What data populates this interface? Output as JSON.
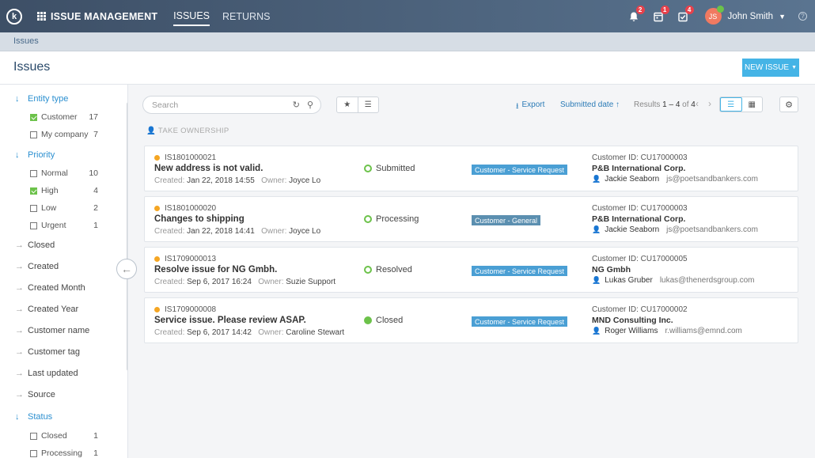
{
  "header": {
    "logo_letter": "k",
    "app_title": "ISSUE MANAGEMENT",
    "tabs": [
      {
        "label": "ISSUES"
      },
      {
        "label": "RETURNS"
      }
    ],
    "notifications": [
      {
        "icon": "bell-icon",
        "count": "2"
      },
      {
        "icon": "calendar-icon",
        "count": "1"
      },
      {
        "icon": "task-icon",
        "count": "4"
      }
    ],
    "user_initials": "JS",
    "user_name": "John Smith"
  },
  "breadcrumb": "Issues",
  "page": {
    "title": "Issues",
    "new_issue_label": "NEW ISSUE"
  },
  "sidebar": {
    "entity_type": {
      "label": "Entity type",
      "options": [
        {
          "label": "Customer",
          "count": "17",
          "checked": true
        },
        {
          "label": "My company",
          "count": "7",
          "checked": false
        }
      ]
    },
    "priority": {
      "label": "Priority",
      "options": [
        {
          "label": "Normal",
          "count": "10",
          "checked": false
        },
        {
          "label": "High",
          "count": "4",
          "checked": true
        },
        {
          "label": "Low",
          "count": "2",
          "checked": false
        },
        {
          "label": "Urgent",
          "count": "1",
          "checked": false
        }
      ]
    },
    "collapsed_filters": [
      "Closed",
      "Created",
      "Created Month",
      "Created Year",
      "Customer name",
      "Customer tag",
      "Last updated",
      "Source"
    ],
    "status": {
      "label": "Status",
      "options": [
        {
          "label": "Closed",
          "count": "1",
          "checked": false
        },
        {
          "label": "Processing",
          "count": "1",
          "checked": false
        }
      ]
    }
  },
  "toolbar": {
    "search_placeholder": "Search",
    "export_label": "Export",
    "sort_label": "Submitted date",
    "results_prefix": "Results",
    "results_range": "1 – 4",
    "results_of": "of",
    "results_total": "4"
  },
  "take_ownership_label": "TAKE OWNERSHIP",
  "issues": [
    {
      "id": "IS1801000021",
      "title": "New address is not valid.",
      "created_label": "Created:",
      "created": "Jan 22, 2018 14:55",
      "owner_label": "Owner:",
      "owner": "Joyce Lo",
      "status": "Submitted",
      "tag": "Customer - Service Request",
      "customer_id": "Customer ID: CU17000003",
      "customer_name": "P&B International Corp.",
      "contact_name": "Jackie Seaborn",
      "contact_email": "js@poetsandbankers.com"
    },
    {
      "id": "IS1801000020",
      "title": "Changes to shipping",
      "created_label": "Created:",
      "created": "Jan 22, 2018 14:41",
      "owner_label": "Owner:",
      "owner": "Joyce Lo",
      "status": "Processing",
      "tag": "Customer - General",
      "customer_id": "Customer ID: CU17000003",
      "customer_name": "P&B International Corp.",
      "contact_name": "Jackie Seaborn",
      "contact_email": "js@poetsandbankers.com"
    },
    {
      "id": "IS1709000013",
      "title": "Resolve issue for NG Gmbh.",
      "created_label": "Created:",
      "created": "Sep 6, 2017 16:24",
      "owner_label": "Owner:",
      "owner": "Suzie Support",
      "status": "Resolved",
      "tag": "Customer - Service Request",
      "customer_id": "Customer ID: CU17000005",
      "customer_name": "NG Gmbh",
      "contact_name": "Lukas Gruber",
      "contact_email": "lukas@thenerdsgroup.com"
    },
    {
      "id": "IS1709000008",
      "title": "Service issue. Please review ASAP.",
      "created_label": "Created:",
      "created": "Sep 6, 2017 14:42",
      "owner_label": "Owner:",
      "owner": "Caroline Stewart",
      "status": "Closed",
      "tag": "Customer - Service Request",
      "customer_id": "Customer ID: CU17000002",
      "customer_name": "MND Consulting Inc.",
      "contact_name": "Roger Williams",
      "contact_email": "r.williams@emnd.com"
    }
  ]
}
